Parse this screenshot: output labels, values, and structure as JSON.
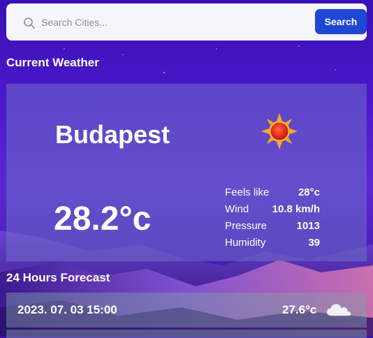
{
  "search": {
    "placeholder": "Search Cities...",
    "button_label": "Search"
  },
  "current": {
    "section_title": "Current Weather",
    "city": "Budapest",
    "temperature": "28.2°c",
    "icon": "sun-icon",
    "details": [
      {
        "label": "Feels like",
        "value": "28°c"
      },
      {
        "label": "Wind",
        "value": "10.8 km/h"
      },
      {
        "label": "Pressure",
        "value": "1013"
      },
      {
        "label": "Humidity",
        "value": "39"
      }
    ]
  },
  "forecast": {
    "section_title": "24 Hours Forecast",
    "items": [
      {
        "time": "2023. 07. 03 15:00",
        "temperature": "27.6°c",
        "icon": "cloud-icon"
      }
    ]
  },
  "colors": {
    "accent": "#1f47d6",
    "background": "#4a18c8"
  }
}
